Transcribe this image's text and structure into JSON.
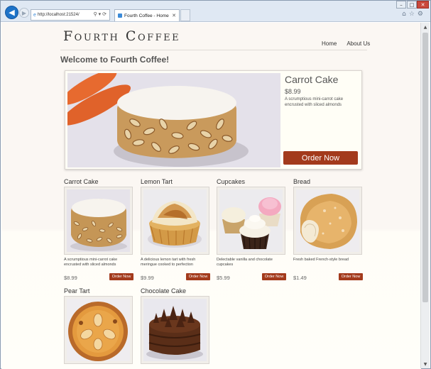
{
  "browser": {
    "address": "http://localhost:21524/",
    "tab_title": "Fourth Coffee - Home",
    "window_controls": {
      "minimize": "–",
      "maximize": "□",
      "close": "✕"
    },
    "icons": [
      "back-arrow-icon",
      "forward-arrow-icon",
      "search-icon",
      "refresh-icon",
      "home-icon",
      "star-icon",
      "gear-icon"
    ]
  },
  "site": {
    "logo": "Fourth Coffee",
    "nav": [
      {
        "label": "Home"
      },
      {
        "label": "About Us"
      }
    ],
    "welcome": "Welcome to Fourth Coffee!"
  },
  "featured": {
    "title": "Carrot Cake",
    "price": "$8.99",
    "description": "A scrumptious mini-carrot cake encrusted with sliced almonds",
    "order_label": "Order Now"
  },
  "products": [
    {
      "title": "Carrot Cake",
      "description": "A scrumptious mini-carrot cake encrusted with sliced almonds",
      "price": "$8.99",
      "order_label": "Order Now"
    },
    {
      "title": "Lemon Tart",
      "description": "A delicious lemon tart with fresh meringue cooked to perfection",
      "price": "$9.99",
      "order_label": "Order Now"
    },
    {
      "title": "Cupcakes",
      "description": "Delectable vanilla and chocolate cupcakes",
      "price": "$5.99",
      "order_label": "Order Now"
    },
    {
      "title": "Bread",
      "description": "Fresh baked French-style bread",
      "price": "$1.49",
      "order_label": "Order Now"
    },
    {
      "title": "Pear Tart"
    },
    {
      "title": "Chocolate Cake"
    }
  ],
  "colors": {
    "accent": "#a33a1c",
    "page_background": "#fbf7f3",
    "browser_chrome": "#dfe8f3"
  }
}
